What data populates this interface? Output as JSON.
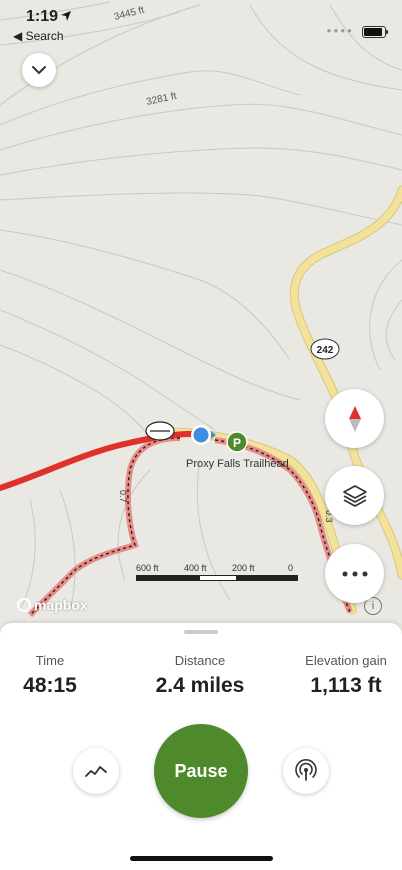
{
  "status": {
    "time": "1:19",
    "back_label": "◀ Search"
  },
  "map": {
    "contour_labels": [
      "3445 ft",
      "3281 ft"
    ],
    "route_shield": "242",
    "trailhead_label": "Proxy Falls Trailhead",
    "parking_marker": "P",
    "trail_distance_labels": [
      "0.7",
      "0.3"
    ],
    "scale_labels": [
      "600 ft",
      "400 ft",
      "200 ft",
      "0"
    ],
    "attribution": "mapbox",
    "info_symbol": "i",
    "colors": {
      "road": "#f3e29b",
      "recorded_track": "#e0302a",
      "trail": "#e98b86",
      "user_location": "#3d8fe0",
      "parking": "#4e8a2b"
    }
  },
  "controls": {
    "collapse_icon": "chevron-down-icon",
    "compass_icon": "compass-icon",
    "layers_icon": "layers-icon",
    "more_icon": "more-icon"
  },
  "stats": [
    {
      "label": "Time",
      "value": "48:15"
    },
    {
      "label": "Distance",
      "value": "2.4 miles"
    },
    {
      "label": "Elevation gain",
      "value": "1,113 ft"
    }
  ],
  "actions": {
    "pause_label": "Pause",
    "elevation_icon": "elevation-chart-icon",
    "broadcast_icon": "broadcast-icon",
    "accent": "#4e8a2b"
  }
}
